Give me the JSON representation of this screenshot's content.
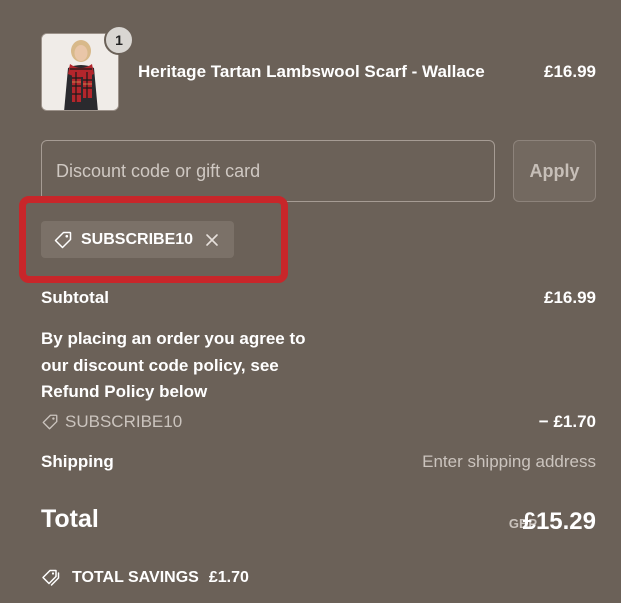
{
  "product": {
    "quantity": "1",
    "title": "Heritage Tartan Lambswool Scarf - Wallace",
    "price": "£16.99",
    "image_icon": "scarf-product-image"
  },
  "discount": {
    "placeholder": "Discount code or gift card",
    "apply_label": "Apply",
    "applied_code": "SUBSCRIBE10"
  },
  "summary": {
    "subtotal_label": "Subtotal",
    "subtotal_value": "£16.99",
    "policy_text": "By placing an order you agree to our discount code policy, see Refund Policy below",
    "discount_code": "SUBSCRIBE10",
    "discount_value": "− £1.70",
    "shipping_label": "Shipping",
    "shipping_value": "Enter shipping address",
    "total_label": "Total",
    "currency": "GBP",
    "total_value": "£15.29",
    "savings_label": "TOTAL SAVINGS",
    "savings_value": "£1.70"
  },
  "colors": {
    "background": "#6b6158",
    "highlight": "#c8262a",
    "chip": "#7b7168"
  }
}
